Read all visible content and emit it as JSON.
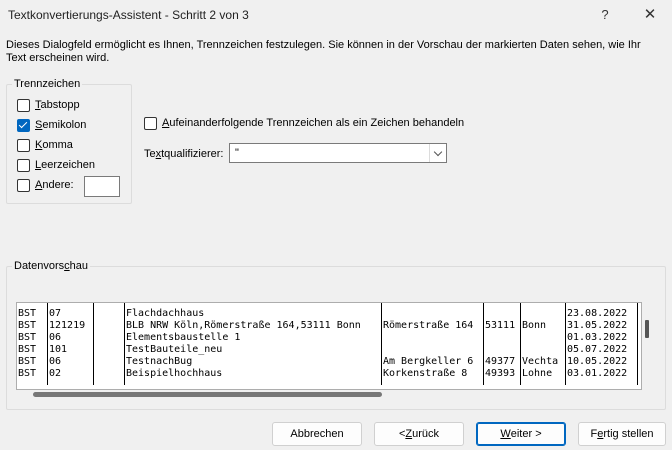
{
  "window": {
    "title": "Textkonvertierungs-Assistent - Schritt 2 von 3",
    "help_label": "?",
    "close_label": "✕"
  },
  "intro_text": "Dieses Dialogfeld ermöglicht es Ihnen, Trennzeichen festzulegen. Sie können in der Vorschau der markierten Daten sehen, wie Ihr Text erscheinen wird.",
  "delimiters": {
    "legend": "Trennzeichen",
    "tab": {
      "mn": "T",
      "rest": "abstopp",
      "checked": false
    },
    "semicolon": {
      "mn": "S",
      "rest": "emikolon",
      "checked": true
    },
    "comma": {
      "mn": "K",
      "rest": "omma",
      "checked": false
    },
    "space": {
      "mn": "L",
      "rest": "eerzeichen",
      "checked": false
    },
    "other": {
      "mn": "A",
      "rest": "ndere:",
      "checked": false,
      "value": ""
    }
  },
  "consecutive": {
    "pre": "",
    "mn": "A",
    "rest": "ufeinanderfolgende Trennzeichen als ein Zeichen behandeln",
    "checked": false
  },
  "qualifier": {
    "pre": "Te",
    "mn": "x",
    "rest": "tqualifizierer:",
    "value": "\""
  },
  "preview": {
    "legend_pre": "Datenvors",
    "legend_mn": "c",
    "legend_rest": "hau",
    "rows": [
      [
        "BST",
        "07",
        "",
        "Flachdachhaus",
        "",
        "",
        "",
        "23.08.2022"
      ],
      [
        "BST",
        "121219",
        "",
        "BLB NRW Köln,Römerstraße 164,53111 Bonn",
        "Römerstraße 164",
        "53111",
        "Bonn",
        "31.05.2022"
      ],
      [
        "BST",
        "06",
        "",
        "Elementsbaustelle 1",
        "",
        "",
        "",
        "01.03.2022"
      ],
      [
        "BST",
        "101",
        "",
        "TestBauteile_neu",
        "",
        "",
        "",
        "05.07.2022"
      ],
      [
        "BST",
        "06",
        "",
        "TestnachBug",
        "Am Bergkeller 6",
        "49377",
        "Vechta",
        "10.05.2022"
      ],
      [
        "BST",
        "02",
        "",
        "Beispielhochhaus",
        "Korkenstraße 8",
        "49393",
        "Lohne",
        "03.01.2022"
      ]
    ]
  },
  "buttons": {
    "cancel": "Abbrechen",
    "back_pre": "< ",
    "back_mn": "Z",
    "back_rest": "urück",
    "next_mn": "W",
    "next_rest": "eiter >",
    "finish_pre": "F",
    "finish_mn": "e",
    "finish_rest": "rtig stellen"
  }
}
